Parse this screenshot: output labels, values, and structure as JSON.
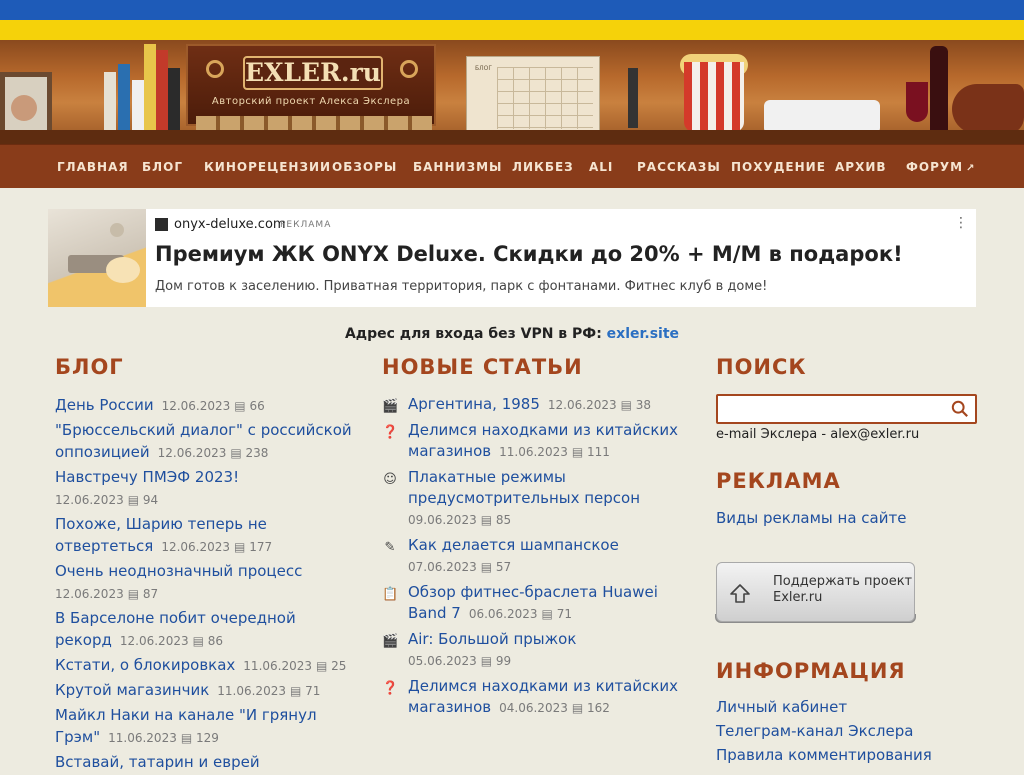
{
  "header": {
    "logo_title": "EXLER.ru",
    "logo_subtitle": "Авторский проект Алекса Экслера",
    "calendar_label": "БЛОГ"
  },
  "nav": {
    "items": [
      {
        "label": "ГЛАВНАЯ"
      },
      {
        "label": "БЛОГ"
      },
      {
        "label": "КИНОРЕЦЕНЗИИ"
      },
      {
        "label": "ОБЗОРЫ"
      },
      {
        "label": "БАННИЗМЫ"
      },
      {
        "label": "ЛИКБЕЗ"
      },
      {
        "label": "ALI"
      },
      {
        "label": "РАССКАЗЫ"
      },
      {
        "label": "ПОХУДЕНИЕ"
      },
      {
        "label": "АРХИВ"
      },
      {
        "label": "ФОРУМ",
        "icon": "external-link-icon"
      }
    ]
  },
  "ad": {
    "domain": "onyx-deluxe.com",
    "label": "РЕКЛАМА",
    "title": "Премиум ЖК ONYX Deluxe. Скидки до 20% + М/М в подарок!",
    "description": "Дом готов к заселению. Приватная территория, парк с фонтанами. Фитнес клуб в доме!",
    "menu_icon": "more-vertical-icon"
  },
  "vpn": {
    "text": "Адрес для входа без VPN в РФ:",
    "link": "exler.site"
  },
  "blog": {
    "title": "БЛОГ",
    "items": [
      {
        "title": "День России",
        "date": "12.06.2023",
        "comments": "66"
      },
      {
        "title": "\"Брюссельский диалог\" с российской оппозицией",
        "date": "12.06.2023",
        "comments": "238"
      },
      {
        "title": "Навстречу ПМЭФ 2023!",
        "date": "12.06.2023",
        "comments": "94"
      },
      {
        "title": "Похоже, Шарию теперь не отвертеться",
        "date": "12.06.2023",
        "comments": "177"
      },
      {
        "title": "Очень неоднозначный процесс",
        "date": "12.06.2023",
        "comments": "87"
      },
      {
        "title": "В Барселоне побит очередной рекорд",
        "date": "12.06.2023",
        "comments": "86"
      },
      {
        "title": "Кстати, о блокировках",
        "date": "11.06.2023",
        "comments": "25"
      },
      {
        "title": "Крутой магазинчик",
        "date": "11.06.2023",
        "comments": "71"
      },
      {
        "title": "Майкл Наки на канале \"И грянул Грэм\"",
        "date": "11.06.2023",
        "comments": "129"
      },
      {
        "title": "Вставай, татарин и еврей",
        "date": "",
        "comments": ""
      }
    ]
  },
  "articles": {
    "title": "НОВЫЕ СТАТЬИ",
    "items": [
      {
        "icon": "movie-clapper-icon",
        "glyph": "🎬",
        "title": "Аргентина, 1985",
        "date": "12.06.2023",
        "comments": "38"
      },
      {
        "icon": "question-icon",
        "glyph": "❓",
        "title": "Делимся находками из китайских магазинов",
        "date": "11.06.2023",
        "comments": "111"
      },
      {
        "icon": "smiley-icon",
        "glyph": "☺",
        "title": "Плакатные режимы предусмотрительных персон",
        "date": "09.06.2023",
        "comments": "85"
      },
      {
        "icon": "pencil-icon",
        "glyph": "✎",
        "title": "Как делается шампанское",
        "date": "07.06.2023",
        "comments": "57"
      },
      {
        "icon": "clipboard-check-icon",
        "glyph": "📋",
        "title": "Обзор фитнес-браслета Huawei Band 7",
        "date": "06.06.2023",
        "comments": "71"
      },
      {
        "icon": "movie-clapper-icon",
        "glyph": "🎬",
        "title": "Air: Большой прыжок",
        "date": "05.06.2023",
        "comments": "99"
      },
      {
        "icon": "question-icon",
        "glyph": "❓",
        "title": "Делимся находками из китайских магазинов",
        "date": "04.06.2023",
        "comments": "162"
      }
    ]
  },
  "sidebar": {
    "search_title": "ПОИСК",
    "search_placeholder": "",
    "email_text": "e-mail Экслера - alex@exler.ru",
    "ads_title": "РЕКЛАМА",
    "ads_link": "Виды рекламы на сайте",
    "support_label": "Поддержать проект Exler.ru",
    "info_title": "ИНФОРМАЦИЯ",
    "info_links": [
      "Личный кабинет",
      "Телеграм-канал Экслера",
      "Правила комментирования"
    ]
  },
  "colors": {
    "nav_bg": "#893c1a",
    "section_title": "#a4461e",
    "link": "#1f4f9e",
    "page_bg": "#edebe0",
    "flag_blue": "#1e5bb8",
    "flag_yellow": "#f5d20a"
  }
}
